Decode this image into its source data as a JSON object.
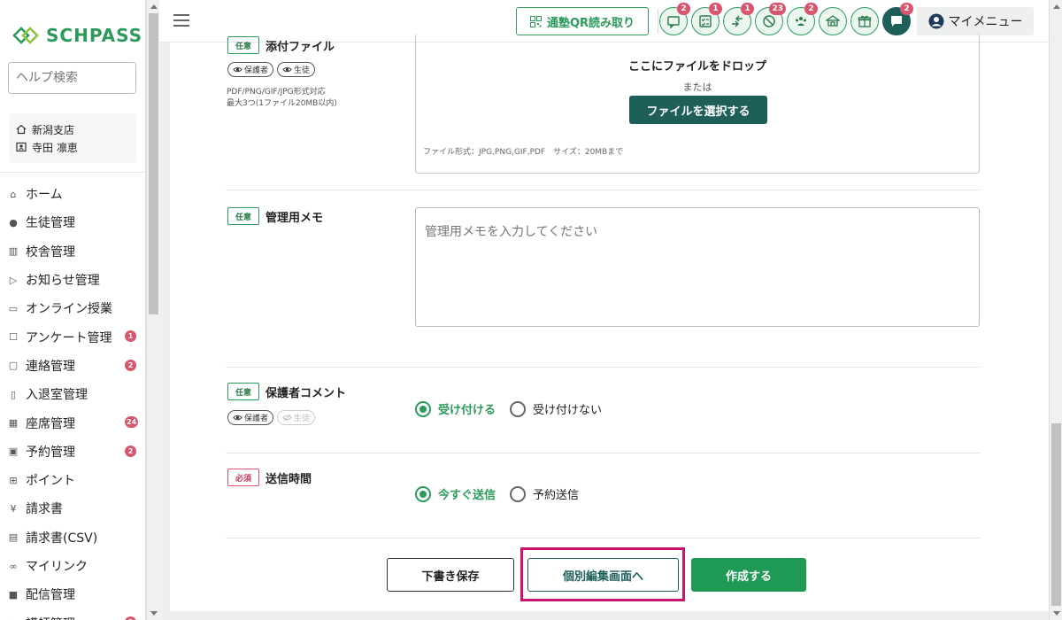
{
  "brand": {
    "name": "SCHPASS",
    "color": "#2b9a5b"
  },
  "sidebar": {
    "search_placeholder": "ヘルプ検索",
    "branch": "新潟支店",
    "user": "寺田 凛恵",
    "items": [
      {
        "label": "ホーム",
        "icon": "home-icon",
        "badge": ""
      },
      {
        "label": "生徒管理",
        "icon": "person-icon",
        "badge": ""
      },
      {
        "label": "校舎管理",
        "icon": "building-icon",
        "badge": ""
      },
      {
        "label": "お知らせ管理",
        "icon": "send-icon",
        "badge": ""
      },
      {
        "label": "オンライン授業",
        "icon": "monitor-icon",
        "badge": ""
      },
      {
        "label": "アンケート管理",
        "icon": "survey-icon",
        "badge": "1"
      },
      {
        "label": "連絡管理",
        "icon": "chat-icon",
        "badge": "2"
      },
      {
        "label": "入退室管理",
        "icon": "door-icon",
        "badge": ""
      },
      {
        "label": "座席管理",
        "icon": "seat-icon",
        "badge": "24"
      },
      {
        "label": "予約管理",
        "icon": "calendar-icon",
        "badge": "2"
      },
      {
        "label": "ポイント",
        "icon": "gift-icon",
        "badge": ""
      },
      {
        "label": "請求書",
        "icon": "yen-icon",
        "badge": ""
      },
      {
        "label": "請求書(CSV)",
        "icon": "csv-icon",
        "badge": ""
      },
      {
        "label": "マイリンク",
        "icon": "link-icon",
        "badge": ""
      },
      {
        "label": "配信管理",
        "icon": "delivery-icon",
        "badge": ""
      },
      {
        "label": "講師管理",
        "icon": "teacher-icon",
        "badge": "2"
      }
    ]
  },
  "header": {
    "qr_label": "通塾QR読み取り",
    "mymenu_label": "マイメニュー",
    "icons": [
      {
        "name": "message-icon",
        "badge": "2"
      },
      {
        "name": "checklist-icon",
        "badge": "1"
      },
      {
        "name": "transfer-icon",
        "badge": "1"
      },
      {
        "name": "absence-icon",
        "badge": "23"
      },
      {
        "name": "group-icon",
        "badge": "2"
      },
      {
        "name": "school-icon",
        "badge": ""
      },
      {
        "name": "gift-icon",
        "badge": ""
      },
      {
        "name": "chat-bubble-icon",
        "badge": "2"
      }
    ]
  },
  "form": {
    "attachment": {
      "tag": "任意",
      "title": "添付ファイル",
      "pills": [
        "保護者",
        "生徒"
      ],
      "note_line1": "PDF/PNG/GIF/JPG形式対応",
      "note_line2": "最大3つ(1ファイル20MB以内)",
      "drop_title": "ここにファイルをドロップ",
      "drop_or": "または",
      "select_button": "ファイルを選択する",
      "hint": "ファイル形式：JPG,PNG,GIF,PDF　サイズ：20MBまで"
    },
    "memo": {
      "tag": "任意",
      "title": "管理用メモ",
      "placeholder": "管理用メモを入力してください"
    },
    "guardian_comment": {
      "tag": "任意",
      "title": "保護者コメント",
      "pills": [
        "保護者",
        "生徒"
      ],
      "options": [
        "受け付ける",
        "受け付けない"
      ],
      "selected": "受け付ける"
    },
    "send_time": {
      "tag": "必須",
      "title": "送信時間",
      "options": [
        "今すぐ送信",
        "予約送信"
      ],
      "selected": "今すぐ送信"
    }
  },
  "actions": {
    "draft": "下書き保存",
    "individual": "個別編集画面へ",
    "create": "作成する"
  }
}
